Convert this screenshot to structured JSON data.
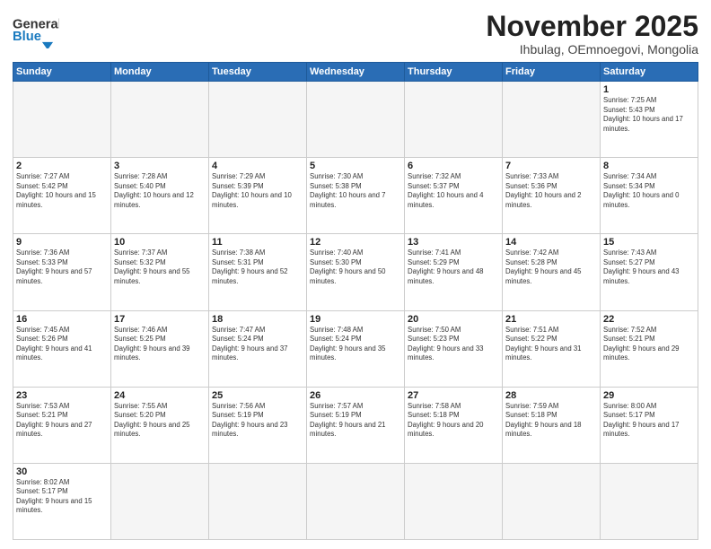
{
  "header": {
    "logo_general": "General",
    "logo_blue": "Blue",
    "month_title": "November 2025",
    "location": "Ihbulag, OEmnoegovi, Mongolia"
  },
  "days_of_week": [
    "Sunday",
    "Monday",
    "Tuesday",
    "Wednesday",
    "Thursday",
    "Friday",
    "Saturday"
  ],
  "weeks": [
    [
      {
        "day": "",
        "empty": true
      },
      {
        "day": "",
        "empty": true
      },
      {
        "day": "",
        "empty": true
      },
      {
        "day": "",
        "empty": true
      },
      {
        "day": "",
        "empty": true
      },
      {
        "day": "",
        "empty": true
      },
      {
        "day": "1",
        "sunrise": "7:25 AM",
        "sunset": "5:43 PM",
        "daylight": "10 hours and 17 minutes."
      }
    ],
    [
      {
        "day": "2",
        "sunrise": "7:27 AM",
        "sunset": "5:42 PM",
        "daylight": "10 hours and 15 minutes."
      },
      {
        "day": "3",
        "sunrise": "7:28 AM",
        "sunset": "5:40 PM",
        "daylight": "10 hours and 12 minutes."
      },
      {
        "day": "4",
        "sunrise": "7:29 AM",
        "sunset": "5:39 PM",
        "daylight": "10 hours and 10 minutes."
      },
      {
        "day": "5",
        "sunrise": "7:30 AM",
        "sunset": "5:38 PM",
        "daylight": "10 hours and 7 minutes."
      },
      {
        "day": "6",
        "sunrise": "7:32 AM",
        "sunset": "5:37 PM",
        "daylight": "10 hours and 4 minutes."
      },
      {
        "day": "7",
        "sunrise": "7:33 AM",
        "sunset": "5:36 PM",
        "daylight": "10 hours and 2 minutes."
      },
      {
        "day": "8",
        "sunrise": "7:34 AM",
        "sunset": "5:34 PM",
        "daylight": "10 hours and 0 minutes."
      }
    ],
    [
      {
        "day": "9",
        "sunrise": "7:36 AM",
        "sunset": "5:33 PM",
        "daylight": "9 hours and 57 minutes."
      },
      {
        "day": "10",
        "sunrise": "7:37 AM",
        "sunset": "5:32 PM",
        "daylight": "9 hours and 55 minutes."
      },
      {
        "day": "11",
        "sunrise": "7:38 AM",
        "sunset": "5:31 PM",
        "daylight": "9 hours and 52 minutes."
      },
      {
        "day": "12",
        "sunrise": "7:40 AM",
        "sunset": "5:30 PM",
        "daylight": "9 hours and 50 minutes."
      },
      {
        "day": "13",
        "sunrise": "7:41 AM",
        "sunset": "5:29 PM",
        "daylight": "9 hours and 48 minutes."
      },
      {
        "day": "14",
        "sunrise": "7:42 AM",
        "sunset": "5:28 PM",
        "daylight": "9 hours and 45 minutes."
      },
      {
        "day": "15",
        "sunrise": "7:43 AM",
        "sunset": "5:27 PM",
        "daylight": "9 hours and 43 minutes."
      }
    ],
    [
      {
        "day": "16",
        "sunrise": "7:45 AM",
        "sunset": "5:26 PM",
        "daylight": "9 hours and 41 minutes."
      },
      {
        "day": "17",
        "sunrise": "7:46 AM",
        "sunset": "5:25 PM",
        "daylight": "9 hours and 39 minutes."
      },
      {
        "day": "18",
        "sunrise": "7:47 AM",
        "sunset": "5:24 PM",
        "daylight": "9 hours and 37 minutes."
      },
      {
        "day": "19",
        "sunrise": "7:48 AM",
        "sunset": "5:24 PM",
        "daylight": "9 hours and 35 minutes."
      },
      {
        "day": "20",
        "sunrise": "7:50 AM",
        "sunset": "5:23 PM",
        "daylight": "9 hours and 33 minutes."
      },
      {
        "day": "21",
        "sunrise": "7:51 AM",
        "sunset": "5:22 PM",
        "daylight": "9 hours and 31 minutes."
      },
      {
        "day": "22",
        "sunrise": "7:52 AM",
        "sunset": "5:21 PM",
        "daylight": "9 hours and 29 minutes."
      }
    ],
    [
      {
        "day": "23",
        "sunrise": "7:53 AM",
        "sunset": "5:21 PM",
        "daylight": "9 hours and 27 minutes."
      },
      {
        "day": "24",
        "sunrise": "7:55 AM",
        "sunset": "5:20 PM",
        "daylight": "9 hours and 25 minutes."
      },
      {
        "day": "25",
        "sunrise": "7:56 AM",
        "sunset": "5:19 PM",
        "daylight": "9 hours and 23 minutes."
      },
      {
        "day": "26",
        "sunrise": "7:57 AM",
        "sunset": "5:19 PM",
        "daylight": "9 hours and 21 minutes."
      },
      {
        "day": "27",
        "sunrise": "7:58 AM",
        "sunset": "5:18 PM",
        "daylight": "9 hours and 20 minutes."
      },
      {
        "day": "28",
        "sunrise": "7:59 AM",
        "sunset": "5:18 PM",
        "daylight": "9 hours and 18 minutes."
      },
      {
        "day": "29",
        "sunrise": "8:00 AM",
        "sunset": "5:17 PM",
        "daylight": "9 hours and 17 minutes."
      }
    ],
    [
      {
        "day": "30",
        "sunrise": "8:02 AM",
        "sunset": "5:17 PM",
        "daylight": "9 hours and 15 minutes.",
        "last": true
      },
      {
        "day": "",
        "empty": true,
        "last": true
      },
      {
        "day": "",
        "empty": true,
        "last": true
      },
      {
        "day": "",
        "empty": true,
        "last": true
      },
      {
        "day": "",
        "empty": true,
        "last": true
      },
      {
        "day": "",
        "empty": true,
        "last": true
      },
      {
        "day": "",
        "empty": true,
        "last": true
      }
    ]
  ]
}
